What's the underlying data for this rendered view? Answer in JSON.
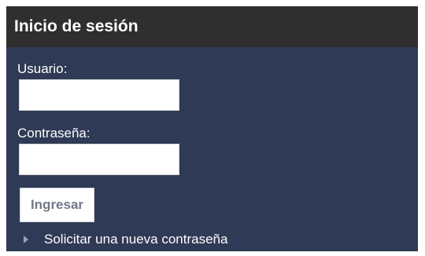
{
  "login_block": {
    "title": "Inicio de sesión",
    "username_label": "Usuario:",
    "username_value": "",
    "password_label": "Contraseña:",
    "password_value": "",
    "submit_label": "Ingresar",
    "request_password_link": "Solicitar una nueva contraseña",
    "link_icon": "triangle-right-icon"
  },
  "colors": {
    "header_background": "#2f2f2f",
    "panel_background": "#2e3a56",
    "text": "#ffffff",
    "button_text": "#6f7b8d"
  }
}
